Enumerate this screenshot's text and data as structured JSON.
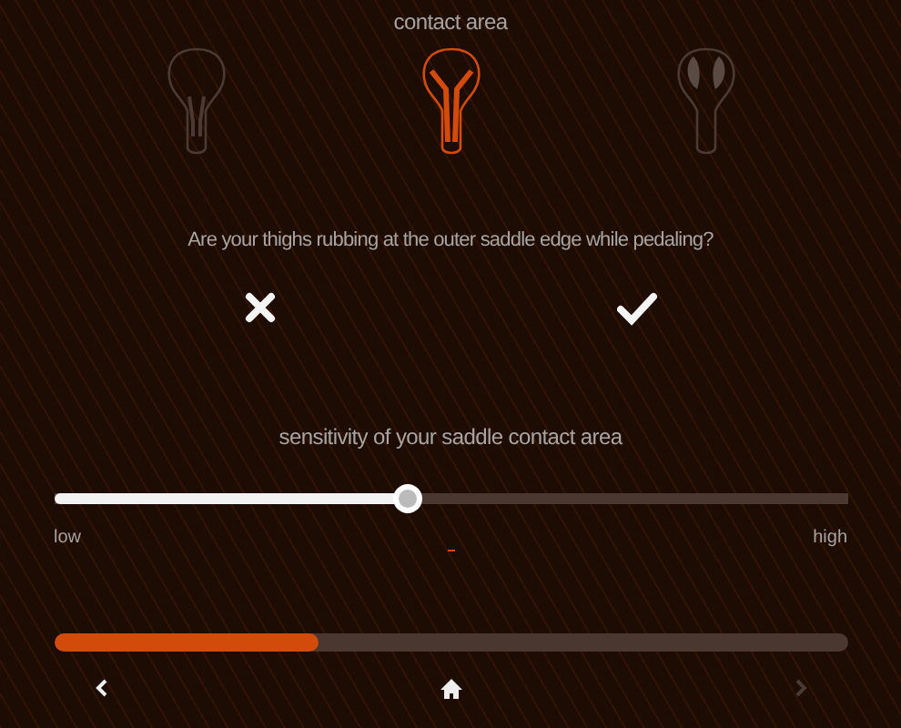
{
  "title": "contact area",
  "saddles": [
    {
      "kind": "narrow",
      "selected": false
    },
    {
      "kind": "channel",
      "selected": true
    },
    {
      "kind": "wide",
      "selected": false
    }
  ],
  "question": "Are your thighs rubbing at the outer saddle edge while pedaling?",
  "answers": [
    {
      "kind": "no",
      "selected": false
    },
    {
      "kind": "yes",
      "selected": false
    }
  ],
  "sensitivity": {
    "label": "sensitivity of your saddle contact area",
    "level": 0.446,
    "low": "low",
    "high": "high"
  },
  "progress": {
    "level": 0.333
  },
  "nav": {
    "back_disabled": false,
    "next_disabled": true
  }
}
